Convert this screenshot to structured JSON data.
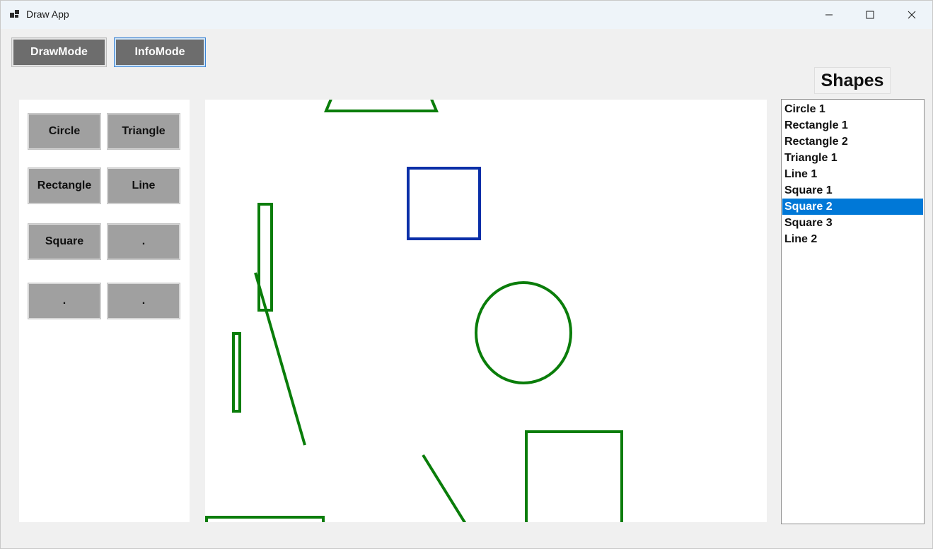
{
  "window": {
    "title": "Draw App"
  },
  "modes": {
    "draw_label": "DrawMode",
    "info_label": "InfoMode"
  },
  "tools": [
    {
      "label": "Circle"
    },
    {
      "label": "Triangle"
    },
    {
      "label": "Rectangle"
    },
    {
      "label": "Line"
    },
    {
      "label": "Square"
    },
    {
      "label": "."
    },
    {
      "label": "."
    },
    {
      "label": "."
    }
  ],
  "shapes_panel": {
    "title": "Shapes",
    "items": [
      {
        "label": "Circle 1",
        "selected": false
      },
      {
        "label": "Rectangle 1",
        "selected": false
      },
      {
        "label": "Rectangle 2",
        "selected": false
      },
      {
        "label": "Triangle 1",
        "selected": false
      },
      {
        "label": "Line 1",
        "selected": false
      },
      {
        "label": "Square 1",
        "selected": false
      },
      {
        "label": "Square 2",
        "selected": true
      },
      {
        "label": "Square 3",
        "selected": false
      },
      {
        "label": "Line 2",
        "selected": false
      }
    ]
  },
  "colors": {
    "shape_stroke": "#0a7d0a",
    "selected_stroke": "#0a2fa8",
    "selection_bg": "#0078d7",
    "button_gray": "#a0a0a0",
    "mode_button": "#6d6d6d"
  }
}
